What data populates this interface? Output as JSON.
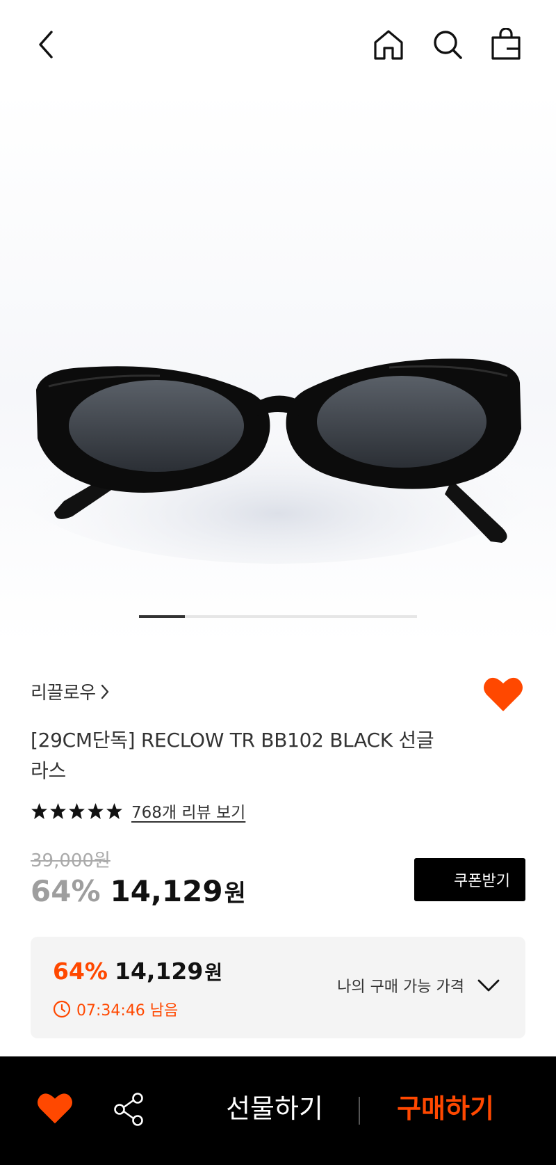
{
  "header": {
    "back_icon": "chevron-left-icon",
    "home_icon": "home-icon",
    "search_icon": "search-icon",
    "bag_icon": "shopping-bag-icon"
  },
  "gallery": {
    "image_subject": "black oval sunglasses",
    "current_index": 1,
    "total": 6
  },
  "product": {
    "brand": "리끌로우",
    "brand_chevron": "›",
    "title": "[29CM단독] RECLOW TR BB102 BLACK 선글라스",
    "rating_stars": 5,
    "review_link": "768개 리뷰 보기",
    "original_price": "39,000원",
    "discount": "64%",
    "price": "14,129",
    "price_unit": "원",
    "coupon_label": "쿠폰받기"
  },
  "best_price": {
    "discount": "64%",
    "price": "14,129",
    "unit": "원",
    "timer": "07:34:46 남음",
    "available_label": "나의 구매 가능 가격"
  },
  "bottom_bar": {
    "gift_label": "선물하기",
    "buy_label": "구매하기"
  },
  "colors": {
    "accent": "#ff4800",
    "black": "#000000",
    "box_bg": "#f4f4f4"
  }
}
